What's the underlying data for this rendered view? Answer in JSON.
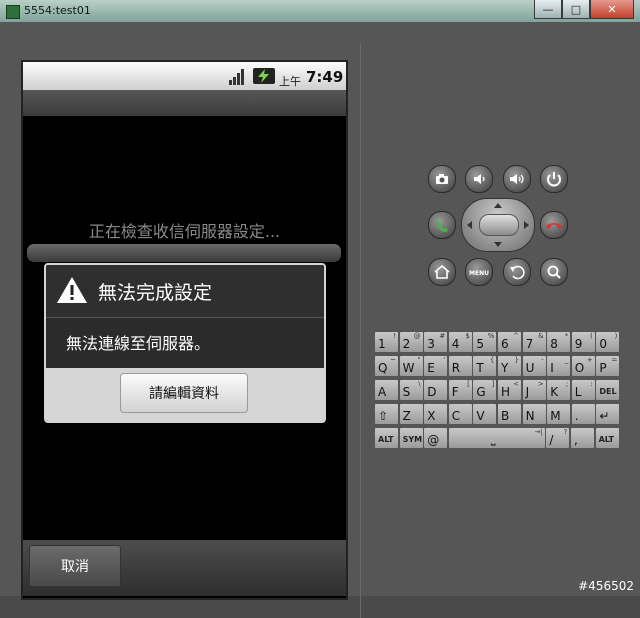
{
  "window": {
    "title": "5554:test01",
    "buttons": {
      "minimize": "—",
      "maximize": "□",
      "close": "✕"
    }
  },
  "status_bar": {
    "ampm": "上午",
    "time": "7:49"
  },
  "screen": {
    "progress_text": "正在檢查收信伺服器設定..."
  },
  "dialog": {
    "title": "無法完成設定",
    "message": "無法連線至伺服器。",
    "button": "請編輯資料"
  },
  "bottom_bar": {
    "cancel": "取消"
  },
  "hardware_buttons": [
    "camera-icon",
    "volume-down-icon",
    "volume-up-icon",
    "power-icon",
    "call-icon",
    "end-call-icon",
    "home-icon",
    "menu-icon",
    "back-icon",
    "search-icon"
  ],
  "menu_label": "MENU",
  "keyboard": {
    "row1": [
      {
        "k": "1",
        "a": "!"
      },
      {
        "k": "2",
        "a": "@"
      },
      {
        "k": "3",
        "a": "#"
      },
      {
        "k": "4",
        "a": "$"
      },
      {
        "k": "5",
        "a": "%"
      },
      {
        "k": "6",
        "a": "^"
      },
      {
        "k": "7",
        "a": "&"
      },
      {
        "k": "8",
        "a": "*"
      },
      {
        "k": "9",
        "a": "("
      },
      {
        "k": "0",
        "a": ")"
      }
    ],
    "row2": [
      {
        "k": "Q",
        "a": "~"
      },
      {
        "k": "W",
        "a": "\""
      },
      {
        "k": "E",
        "a": "'"
      },
      {
        "k": "R",
        "a": ""
      },
      {
        "k": "T",
        "a": "{"
      },
      {
        "k": "Y",
        "a": "}"
      },
      {
        "k": "U",
        "a": "-"
      },
      {
        "k": "I",
        "a": "_"
      },
      {
        "k": "O",
        "a": "+"
      },
      {
        "k": "P",
        "a": "="
      }
    ],
    "row3": [
      {
        "k": "A",
        "a": ""
      },
      {
        "k": "S",
        "a": "\\"
      },
      {
        "k": "D",
        "a": ""
      },
      {
        "k": "F",
        "a": "["
      },
      {
        "k": "G",
        "a": "]"
      },
      {
        "k": "H",
        "a": "<"
      },
      {
        "k": "J",
        "a": ">"
      },
      {
        "k": "K",
        "a": ";"
      },
      {
        "k": "L",
        "a": ":"
      },
      {
        "k": "DEL",
        "a": ""
      }
    ],
    "row4": [
      {
        "k": "⇧",
        "a": ""
      },
      {
        "k": "Z",
        "a": ""
      },
      {
        "k": "X",
        "a": ""
      },
      {
        "k": "C",
        "a": ""
      },
      {
        "k": "V",
        "a": ""
      },
      {
        "k": "B",
        "a": ""
      },
      {
        "k": "N",
        "a": ""
      },
      {
        "k": "M",
        "a": ""
      },
      {
        "k": ".",
        "a": ""
      },
      {
        "k": "↵",
        "a": ""
      }
    ],
    "row5": [
      {
        "k": "ALT",
        "a": ""
      },
      {
        "k": "SYM",
        "a": ""
      },
      {
        "k": "@",
        "a": ""
      },
      {
        "k": "⎵",
        "a": "→|"
      },
      {
        "k": "/",
        "a": "?"
      },
      {
        "k": ",",
        "a": ""
      },
      {
        "k": "ALT",
        "a": ""
      }
    ]
  },
  "watermark": "#456502"
}
